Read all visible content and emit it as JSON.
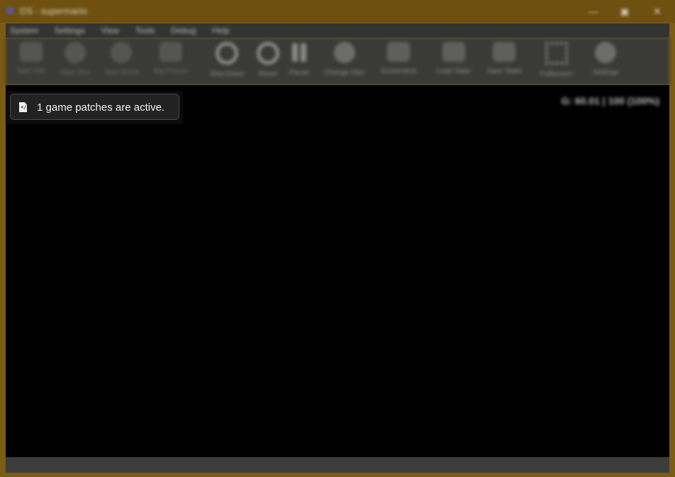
{
  "window": {
    "title": "DS - supermario"
  },
  "window_controls": {
    "minimize": "—",
    "maximize": "▣",
    "close": "✕"
  },
  "menu": {
    "items": [
      "System",
      "Settings",
      "View",
      "Tools",
      "Debug",
      "Help"
    ]
  },
  "toolbar": {
    "items": [
      {
        "label": "Start File",
        "icon": "file-icon"
      },
      {
        "label": "Start Disc",
        "icon": "disc-icon"
      },
      {
        "label": "Start BIOS",
        "icon": "bios-icon"
      },
      {
        "label": "Big Picture",
        "icon": "monitor-icon"
      },
      {
        "label": "Shut Down",
        "icon": "power-icon"
      },
      {
        "label": "Reset",
        "icon": "reset-icon"
      },
      {
        "label": "Pause",
        "icon": "pause-icon"
      },
      {
        "label": "Change Disc",
        "icon": "disc-icon"
      },
      {
        "label": "Screenshot",
        "icon": "camera-icon"
      },
      {
        "label": "Load State",
        "icon": "load-icon"
      },
      {
        "label": "Save State",
        "icon": "save-icon"
      },
      {
        "label": "Fullscreen",
        "icon": "fullscreen-icon"
      },
      {
        "label": "Settings",
        "icon": "gear-icon"
      }
    ]
  },
  "display": {
    "perf_overlay": "G: 60.01 | 100 (100%)"
  },
  "toast": {
    "message": "1 game patches are active.",
    "icon": "file-code-icon"
  },
  "status": {
    "text": ""
  }
}
